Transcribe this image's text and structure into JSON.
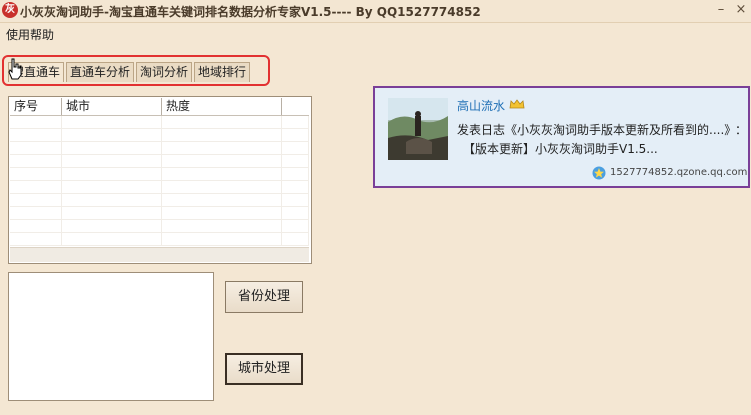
{
  "window": {
    "title": "小灰灰淘词助手-淘宝直通车关键词排名数据分析专家V1.5---- By QQ1527774852",
    "app_icon_glyph": "灰",
    "minimize_glyph": "–",
    "close_glyph": "×"
  },
  "menu": {
    "help": "使用帮助"
  },
  "tabs": [
    {
      "label": "搜直通车",
      "active": true
    },
    {
      "label": "直通车分析",
      "active": false
    },
    {
      "label": "淘词分析",
      "active": false
    },
    {
      "label": "地域排行",
      "active": false
    }
  ],
  "table": {
    "columns": [
      "序号",
      "城市",
      "热度"
    ],
    "rows": []
  },
  "buttons": {
    "province": "省份处理",
    "city": "城市处理"
  },
  "qzone": {
    "username": "高山流水",
    "log_text": "发表日志《小灰灰淘词助手版本更新及所看到的....》",
    "colon": "：",
    "update_text": "【版本更新】小灰灰淘词助手V1.5...",
    "link": "1527774852.qzone.qq.com"
  },
  "colors": {
    "background": "#f4e7d3",
    "highlight_border": "#e23131",
    "card_border": "#7a3f98",
    "card_bg": "#e4eef7",
    "username": "#1f6fb5"
  }
}
